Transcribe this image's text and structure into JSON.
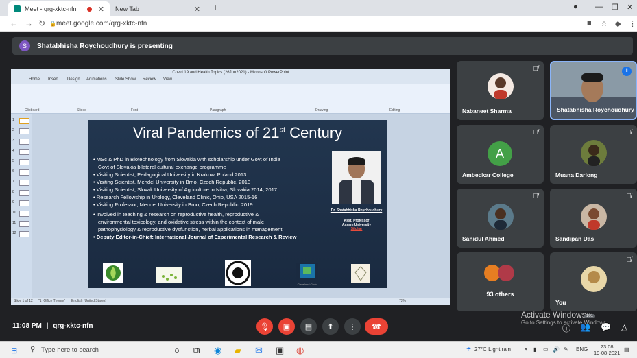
{
  "browser": {
    "tabs": [
      {
        "label": "Meet - qrg-xktc-nfn"
      },
      {
        "label": "New Tab"
      }
    ],
    "new_tab_symbol": "+",
    "url": "meet.google.com/qrg-xktc-nfn"
  },
  "presenting_banner": {
    "avatar_letter": "S",
    "text": "Shatabhisha Roychoudhury is presenting"
  },
  "powerpoint": {
    "window_title": "Covid 19 and Health Topics (26Jun2021) - Microsoft PowerPoint",
    "ribbon_tabs": [
      "Home",
      "Insert",
      "Design",
      "Animations",
      "Slide Show",
      "Review",
      "View"
    ],
    "ribbon_groups": [
      "Clipboard",
      "Slides",
      "Font",
      "Paragraph",
      "Drawing",
      "Editing"
    ],
    "status": {
      "slide": "Slide 1 of 12",
      "theme": "\"1_Office Theme\"",
      "language": "English (United States)",
      "zoom": "73%"
    },
    "thumb_numbers": [
      "1",
      "2",
      "3",
      "4",
      "5",
      "6",
      "7",
      "8",
      "9",
      "10",
      "11",
      "12"
    ]
  },
  "slide": {
    "title_main": "Viral Pandemics of 21",
    "title_sup": "st",
    "title_end": " Century",
    "bullets": [
      "MSc & PhD in Biotechnology from Slovakia with scholarship under Govt of India –",
      "Govt of Slovakia bilateral cultural exchange programme",
      "Visiting Scientist, Pedagogical University in Krakow, Poland 2013",
      "Visiting Scientist, Mendel University in Brno, Czech Republic, 2013",
      "Visiting Scientist, Slovak University of Agriculture in Nitra, Slovakia 2014, 2017",
      "Research Fellowship in Urology, Cleveland Clinic, Ohio, USA 2015-16",
      "Visiting Professor, Mendel University in Brno, Czech Republic, 2019",
      "Involved in teaching & research on reproductive health, reproductive &",
      "environmental toxicology, and oxidative stress within the context of male",
      "pathophysiology & reproductive dysfunction, herbal applications in management",
      "Deputy Editor-in-Chief: International Journal of Experimental Research & Review"
    ],
    "name": "Dr. Shatabhisha Roychoudhury",
    "designation": "Asst. Professor",
    "university": "Assam University",
    "place": "Silchar",
    "logo_caption": "Cleveland Clinic"
  },
  "participants": [
    {
      "name": "Nabaneet Sharma",
      "muted": true
    },
    {
      "name": "Shatabhisha Roychoudhury",
      "speaking": true
    },
    {
      "name": "Ambedkar College",
      "letter": "A",
      "muted": true
    },
    {
      "name": "Muana Darlong",
      "muted": true
    },
    {
      "name": "Sahidul Ahmed",
      "muted": true
    },
    {
      "name": "Sandipan Das",
      "muted": true
    },
    {
      "name": "93 others"
    },
    {
      "name": "You",
      "muted": true
    }
  ],
  "watermark": {
    "line1": "Activate Windows",
    "line2": "Go to Settings to activate Windows."
  },
  "meeting": {
    "time": "11:08 PM",
    "separator": "|",
    "code": "qrg-xktc-nfn",
    "people_count": "101"
  },
  "taskbar": {
    "search_placeholder": "Type here to search",
    "weather": "27°C  Light rain",
    "language": "ENG",
    "time": "23:08",
    "date": "19-08-2021"
  }
}
